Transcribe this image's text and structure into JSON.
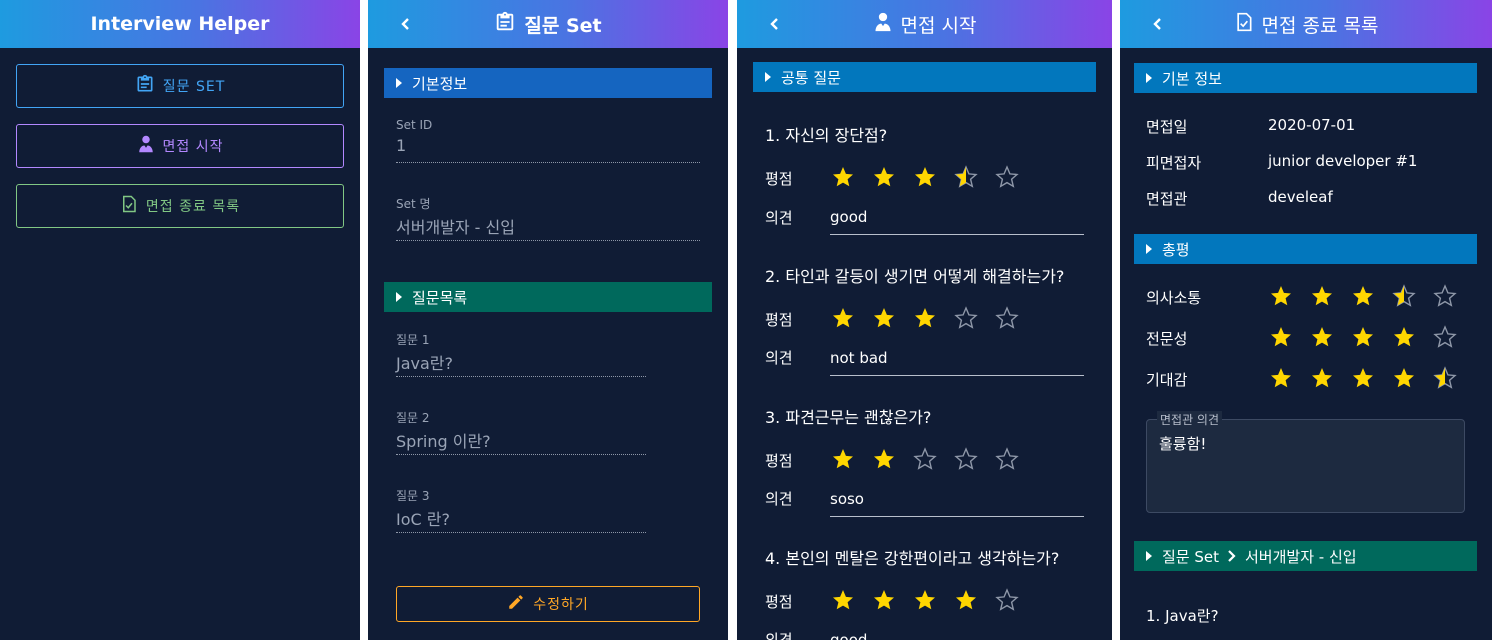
{
  "panel1": {
    "title": "Interview Helper",
    "menu": [
      {
        "label": "질문 SET",
        "color": "#42a5f5"
      },
      {
        "label": "면접 시작",
        "color": "#b388ff"
      },
      {
        "label": "면접 종료 목록",
        "color": "#81c784"
      }
    ]
  },
  "panel2": {
    "title": "질문 Set",
    "section_basic": "기본정보",
    "set_id_label": "Set ID",
    "set_id_value": "1",
    "set_name_label": "Set 명",
    "set_name_value": "서버개발자 - 신입",
    "section_questions": "질문목록",
    "questions": [
      {
        "label": "질문 1",
        "value": "Java란?"
      },
      {
        "label": "질문 2",
        "value": "Spring 이란?"
      },
      {
        "label": "질문 3",
        "value": "IoC 란?"
      }
    ],
    "edit_button": "수정하기"
  },
  "panel3": {
    "title": "면접 시작",
    "section_common": "공통 질문",
    "rating_label": "평점",
    "opinion_label": "의견",
    "questions": [
      {
        "text": "1. 자신의 장단점?",
        "rating": 3.5,
        "opinion": "good"
      },
      {
        "text": "2. 타인과 갈등이 생기면 어떻게 해결하는가?",
        "rating": 3,
        "opinion": "not bad"
      },
      {
        "text": "3. 파견근무는 괜찮은가?",
        "rating": 2,
        "opinion": "soso"
      },
      {
        "text": "4. 본인의 멘탈은 강한편이라고 생각하는가?",
        "rating": 4,
        "opinion": "good"
      }
    ]
  },
  "panel4": {
    "title": "면접 종료 목록",
    "section_basic": "기본 정보",
    "info": [
      {
        "key": "면접일",
        "value": "2020-07-01"
      },
      {
        "key": "피면접자",
        "value": "junior developer #1"
      },
      {
        "key": "면접관",
        "value": "develeaf"
      }
    ],
    "section_summary": "총평",
    "scores": [
      {
        "key": "의사소통",
        "rating": 3.5
      },
      {
        "key": "전문성",
        "rating": 4
      },
      {
        "key": "기대감",
        "rating": 4.5
      }
    ],
    "opinion_legend": "면접관 의견",
    "opinion_text": "훌륭함!",
    "section_set_prefix": "질문 Set",
    "section_set_name": "서버개발자 - 신입",
    "first_question": "1. Java란?"
  },
  "colors": {
    "star": "#ffd600",
    "orange": "#ffa726",
    "bg": "#101c35"
  }
}
